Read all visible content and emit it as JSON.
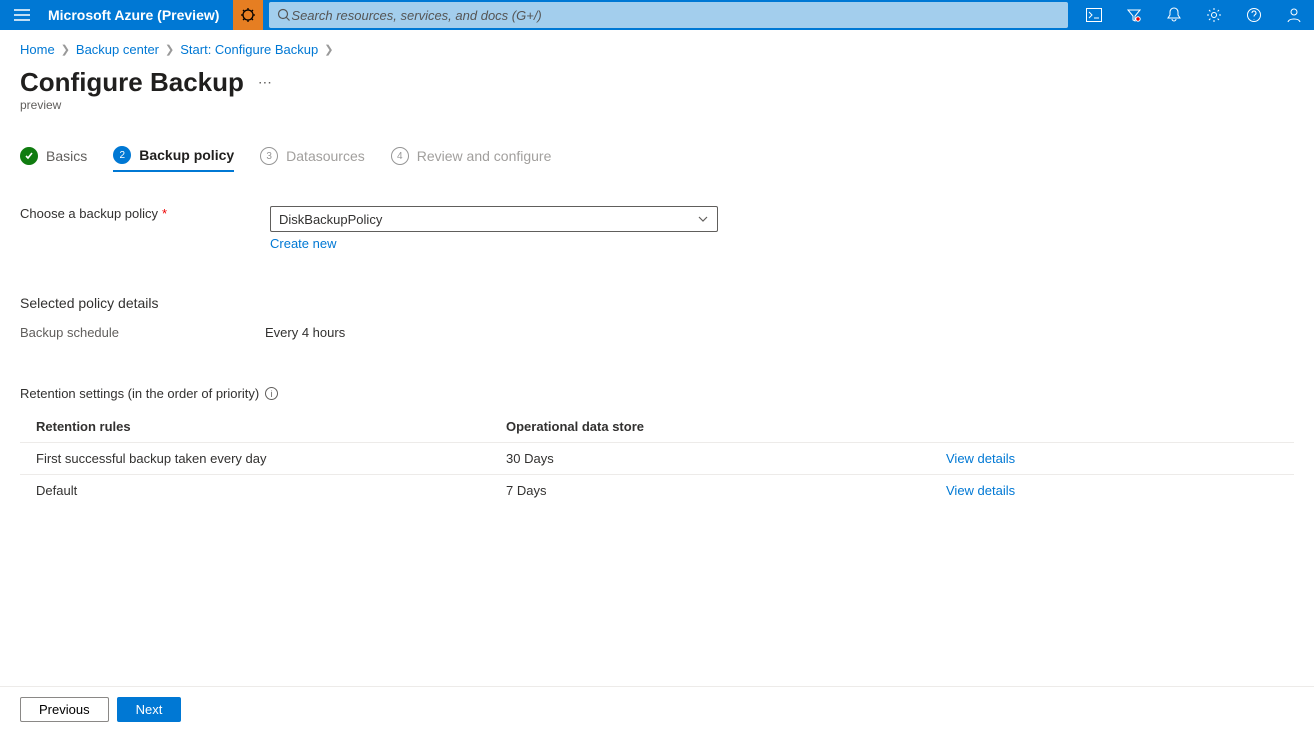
{
  "header": {
    "brand": "Microsoft Azure (Preview)",
    "search_placeholder": "Search resources, services, and docs (G+/)"
  },
  "breadcrumb": {
    "items": [
      "Home",
      "Backup center",
      "Start: Configure Backup"
    ]
  },
  "page": {
    "title": "Configure Backup",
    "subtitle": "preview"
  },
  "steps": {
    "s1": {
      "num": "✓",
      "label": "Basics"
    },
    "s2": {
      "num": "2",
      "label": "Backup policy"
    },
    "s3": {
      "num": "3",
      "label": "Datasources"
    },
    "s4": {
      "num": "4",
      "label": "Review and configure"
    }
  },
  "form": {
    "policy_label": "Choose a backup policy",
    "policy_value": "DiskBackupPolicy",
    "create_new": "Create new"
  },
  "details": {
    "heading": "Selected policy details",
    "schedule_k": "Backup schedule",
    "schedule_v": "Every 4 hours"
  },
  "retention": {
    "heading": "Retention settings (in the order of priority)",
    "head_col1": "Retention rules",
    "head_col2": "Operational data store",
    "rows": [
      {
        "rule": "First successful backup taken every day",
        "store": "30 Days",
        "action": "View details"
      },
      {
        "rule": "Default",
        "store": "7 Days",
        "action": "View details"
      }
    ]
  },
  "footer": {
    "prev": "Previous",
    "next": "Next"
  }
}
